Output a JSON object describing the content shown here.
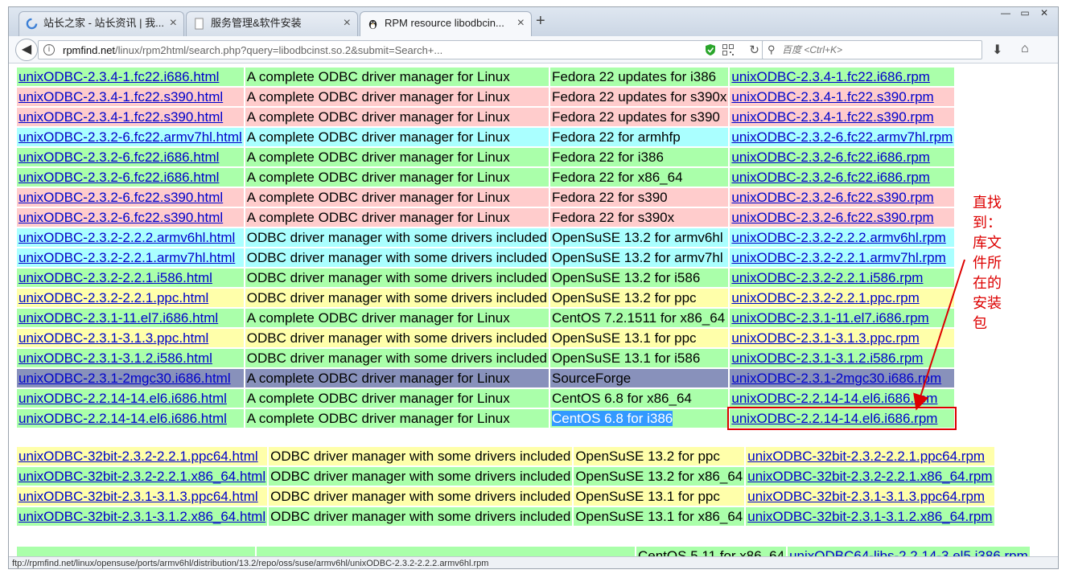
{
  "tabs": [
    {
      "title": "站长之家 - 站长资讯 | 我...",
      "icon": "loading-circle-icon"
    },
    {
      "title": "服务管理&软件安装",
      "icon": "page-icon"
    },
    {
      "title": "RPM resource libodbcin...",
      "icon": "tux-icon"
    }
  ],
  "nav": {
    "url_host": "rpmfind.net",
    "url_path": "/linux/rpm2html/search.php?query=libodbcinst.so.2&submit=Search+...",
    "search_placeholder": "百度 <Ctrl+K>"
  },
  "table1": [
    {
      "html": "unixODBC-2.3.4-1.fc22.i686.html",
      "summary": "A complete ODBC driver manager for Linux",
      "dist": "Fedora 22 updates for i386",
      "rpm": "unixODBC-2.3.4-1.fc22.i686.rpm",
      "color": "g"
    },
    {
      "html": "unixODBC-2.3.4-1.fc22.s390.html",
      "summary": "A complete ODBC driver manager for Linux",
      "dist": "Fedora 22 updates for s390x",
      "rpm": "unixODBC-2.3.4-1.fc22.s390.rpm",
      "color": "r"
    },
    {
      "html": "unixODBC-2.3.4-1.fc22.s390.html",
      "summary": "A complete ODBC driver manager for Linux",
      "dist": "Fedora 22 updates for s390",
      "rpm": "unixODBC-2.3.4-1.fc22.s390.rpm",
      "color": "r"
    },
    {
      "html": "unixODBC-2.3.2-6.fc22.armv7hl.html",
      "summary": "A complete ODBC driver manager for Linux",
      "dist": "Fedora 22 for armhfp",
      "rpm": "unixODBC-2.3.2-6.fc22.armv7hl.rpm",
      "color": "c"
    },
    {
      "html": "unixODBC-2.3.2-6.fc22.i686.html",
      "summary": "A complete ODBC driver manager for Linux",
      "dist": "Fedora 22 for i386",
      "rpm": "unixODBC-2.3.2-6.fc22.i686.rpm",
      "color": "g"
    },
    {
      "html": "unixODBC-2.3.2-6.fc22.i686.html",
      "summary": "A complete ODBC driver manager for Linux",
      "dist": "Fedora 22 for x86_64",
      "rpm": "unixODBC-2.3.2-6.fc22.i686.rpm",
      "color": "g"
    },
    {
      "html": "unixODBC-2.3.2-6.fc22.s390.html",
      "summary": "A complete ODBC driver manager for Linux",
      "dist": "Fedora 22 for s390",
      "rpm": "unixODBC-2.3.2-6.fc22.s390.rpm",
      "color": "r"
    },
    {
      "html": "unixODBC-2.3.2-6.fc22.s390.html",
      "summary": "A complete ODBC driver manager for Linux",
      "dist": "Fedora 22 for s390x",
      "rpm": "unixODBC-2.3.2-6.fc22.s390.rpm",
      "color": "r"
    },
    {
      "html": "unixODBC-2.3.2-2.2.2.armv6hl.html",
      "summary": "ODBC driver manager with some drivers included",
      "dist": "OpenSuSE 13.2 for armv6hl",
      "rpm": "unixODBC-2.3.2-2.2.2.armv6hl.rpm",
      "color": "c"
    },
    {
      "html": "unixODBC-2.3.2-2.2.1.armv7hl.html",
      "summary": "ODBC driver manager with some drivers included",
      "dist": "OpenSuSE 13.2 for armv7hl",
      "rpm": "unixODBC-2.3.2-2.2.1.armv7hl.rpm",
      "color": "c"
    },
    {
      "html": "unixODBC-2.3.2-2.2.1.i586.html",
      "summary": "ODBC driver manager with some drivers included",
      "dist": "OpenSuSE 13.2 for i586",
      "rpm": "unixODBC-2.3.2-2.2.1.i586.rpm",
      "color": "g"
    },
    {
      "html": "unixODBC-2.3.2-2.2.1.ppc.html",
      "summary": "ODBC driver manager with some drivers included",
      "dist": "OpenSuSE 13.2 for ppc",
      "rpm": "unixODBC-2.3.2-2.2.1.ppc.rpm",
      "color": "y"
    },
    {
      "html": "unixODBC-2.3.1-11.el7.i686.html",
      "summary": "A complete ODBC driver manager for Linux",
      "dist": "CentOS 7.2.1511 for x86_64",
      "rpm": "unixODBC-2.3.1-11.el7.i686.rpm",
      "color": "g"
    },
    {
      "html": "unixODBC-2.3.1-3.1.3.ppc.html",
      "summary": "ODBC driver manager with some drivers included",
      "dist": "OpenSuSE 13.1 for ppc",
      "rpm": "unixODBC-2.3.1-3.1.3.ppc.rpm",
      "color": "y"
    },
    {
      "html": "unixODBC-2.3.1-3.1.2.i586.html",
      "summary": "ODBC driver manager with some drivers included",
      "dist": "OpenSuSE 13.1 for i586",
      "rpm": "unixODBC-2.3.1-3.1.2.i586.rpm",
      "color": "g"
    },
    {
      "html": "unixODBC-2.3.1-2mgc30.i686.html",
      "summary": "A complete ODBC driver manager for Linux",
      "dist": "SourceForge",
      "rpm": "unixODBC-2.3.1-2mgc30.i686.rpm",
      "color": "p"
    },
    {
      "html": "unixODBC-2.2.14-14.el6.i686.html",
      "summary": "A complete ODBC driver manager for Linux",
      "dist": "CentOS 6.8 for x86_64",
      "rpm": "unixODBC-2.2.14-14.el6.i686.rpm",
      "color": "g"
    },
    {
      "html": "unixODBC-2.2.14-14.el6.i686.html",
      "summary": "A complete ODBC driver manager for Linux",
      "dist": "CentOS 6.8 for i386",
      "rpm": "unixODBC-2.2.14-14.el6.i686.rpm",
      "color": "g",
      "selected": true,
      "boxed": true
    }
  ],
  "table2": [
    {
      "html": "unixODBC-32bit-2.3.2-2.2.1.ppc64.html",
      "summary": "ODBC driver manager with some drivers included",
      "dist": "OpenSuSE 13.2 for ppc",
      "rpm": "unixODBC-32bit-2.3.2-2.2.1.ppc64.rpm",
      "color": "y"
    },
    {
      "html": "unixODBC-32bit-2.3.2-2.2.1.x86_64.html",
      "summary": "ODBC driver manager with some drivers included",
      "dist": "OpenSuSE 13.2 for x86_64",
      "rpm": "unixODBC-32bit-2.3.2-2.2.1.x86_64.rpm",
      "color": "g"
    },
    {
      "html": "unixODBC-32bit-2.3.1-3.1.3.ppc64.html",
      "summary": "ODBC driver manager with some drivers included",
      "dist": "OpenSuSE 13.1 for ppc",
      "rpm": "unixODBC-32bit-2.3.1-3.1.3.ppc64.rpm",
      "color": "y"
    },
    {
      "html": "unixODBC-32bit-2.3.1-3.1.2.x86_64.html",
      "summary": "ODBC driver manager with some drivers included",
      "dist": "OpenSuSE 13.1 for x86_64",
      "rpm": "unixODBC-32bit-2.3.1-3.1.2.x86_64.rpm",
      "color": "g"
    }
  ],
  "table3_partial": {
    "dist": "CentOS 5.11 for x86_64",
    "rpm": "unixODBC64-libs-2.2.14-3.el5.i386.rpm",
    "color": "g"
  },
  "annotation": "直找到：库文件所在的安装包",
  "status_text": "ftp://rpmfind.net/linux/opensuse/ports/armv6hl/distribution/13.2/repo/oss/suse/armv6hl/unixODBC-2.3.2-2.2.2.armv6hl.rpm",
  "colors": {
    "green": "#aaffaa",
    "red": "#ffcccc",
    "cyan": "#aaffff",
    "yellow": "#ffffaa",
    "purple": "#8891bb",
    "link": "#0000cc",
    "annotation": "#dd0000",
    "selection": "#3399ff"
  }
}
